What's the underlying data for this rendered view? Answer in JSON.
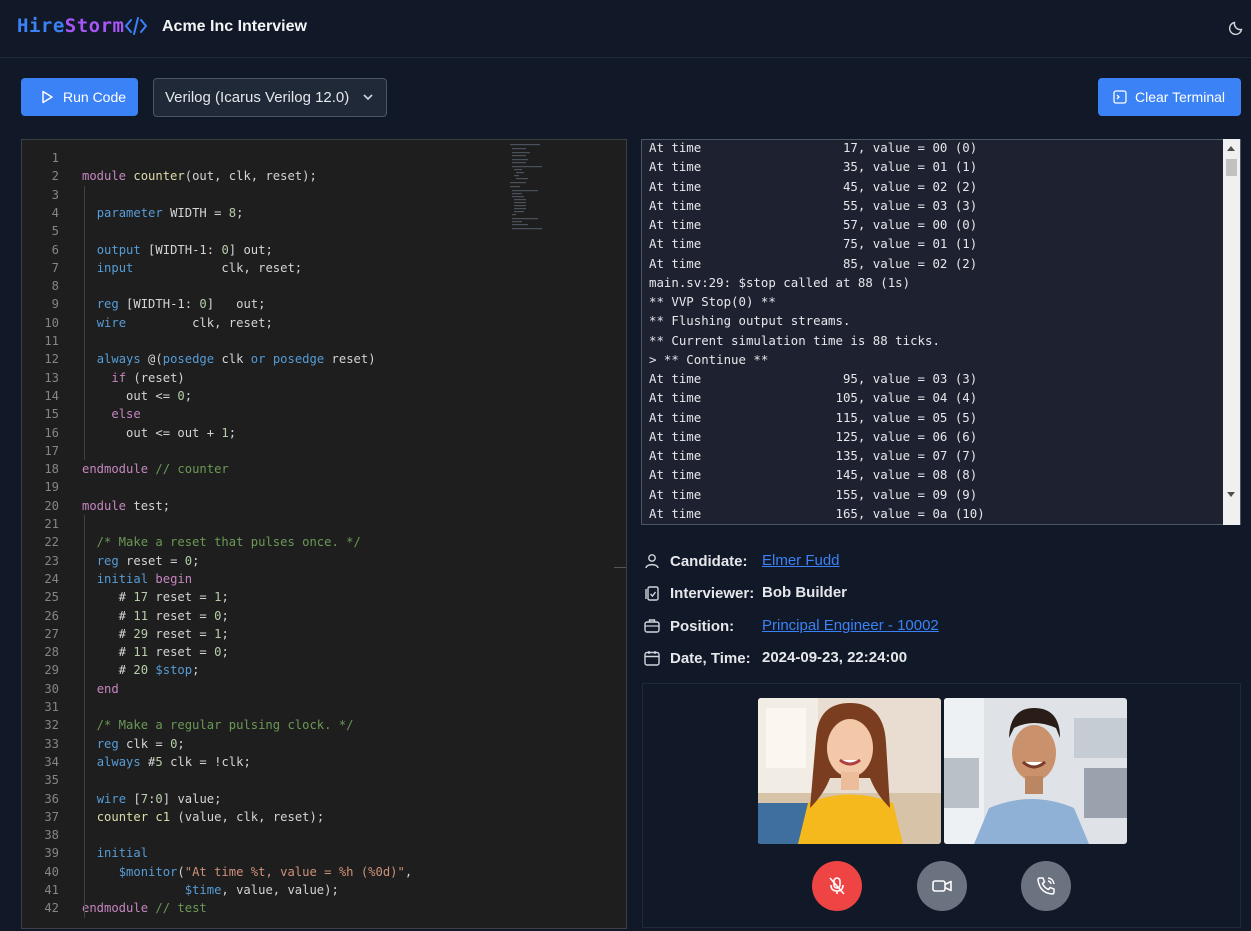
{
  "header": {
    "logo_part1": "Hire",
    "logo_part2": "Storm",
    "title": "Acme Inc Interview"
  },
  "toolbar": {
    "run_label": "Run Code",
    "language": "Verilog (Icarus Verilog 12.0)",
    "clear_label": "Clear Terminal"
  },
  "editor": {
    "lines": [
      "",
      "module counter(out, clk, reset);",
      "",
      "  parameter WIDTH = 8;",
      "",
      "  output [WIDTH-1: 0] out;",
      "  input            clk, reset;",
      "",
      "  reg [WIDTH-1: 0]   out;",
      "  wire         clk, reset;",
      "",
      "  always @(posedge clk or posedge reset)",
      "    if (reset)",
      "      out <= 0;",
      "    else",
      "      out <= out + 1;",
      "",
      "endmodule // counter",
      "",
      "module test;",
      "",
      "  /* Make a reset that pulses once. */",
      "  reg reset = 0;",
      "  initial begin",
      "     # 17 reset = 1;",
      "     # 11 reset = 0;",
      "     # 29 reset = 1;",
      "     # 11 reset = 0;",
      "     # 20 $stop;",
      "  end",
      "",
      "  /* Make a regular pulsing clock. */",
      "  reg clk = 0;",
      "  always #5 clk = !clk;",
      "",
      "  wire [7:0] value;",
      "  counter c1 (value, clk, reset);",
      "",
      "  initial",
      "     $monitor(\"At time %t, value = %h (%0d)\",",
      "              $time, value, value);",
      "endmodule // test"
    ]
  },
  "terminal": {
    "lines": [
      "At time                   17, value = 00 (0)",
      "At time                   35, value = 01 (1)",
      "At time                   45, value = 02 (2)",
      "At time                   55, value = 03 (3)",
      "At time                   57, value = 00 (0)",
      "At time                   75, value = 01 (1)",
      "At time                   85, value = 02 (2)",
      "main.sv:29: $stop called at 88 (1s)",
      "** VVP Stop(0) **",
      "** Flushing output streams.",
      "** Current simulation time is 88 ticks.",
      "> ** Continue **",
      "At time                   95, value = 03 (3)",
      "At time                  105, value = 04 (4)",
      "At time                  115, value = 05 (5)",
      "At time                  125, value = 06 (6)",
      "At time                  135, value = 07 (7)",
      "At time                  145, value = 08 (8)",
      "At time                  155, value = 09 (9)",
      "At time                  165, value = 0a (10)"
    ]
  },
  "details": {
    "candidate_label": "Candidate:",
    "candidate_value": "Elmer Fudd",
    "interviewer_label": "Interviewer:",
    "interviewer_value": "Bob Builder",
    "position_label": "Position:",
    "position_value": "Principal Engineer - 10002",
    "datetime_label": "Date, Time:",
    "datetime_value": "2024-09-23, 22:24:00"
  },
  "video": {
    "mute_color": "#ef4444",
    "control_color": "#6b7280"
  }
}
